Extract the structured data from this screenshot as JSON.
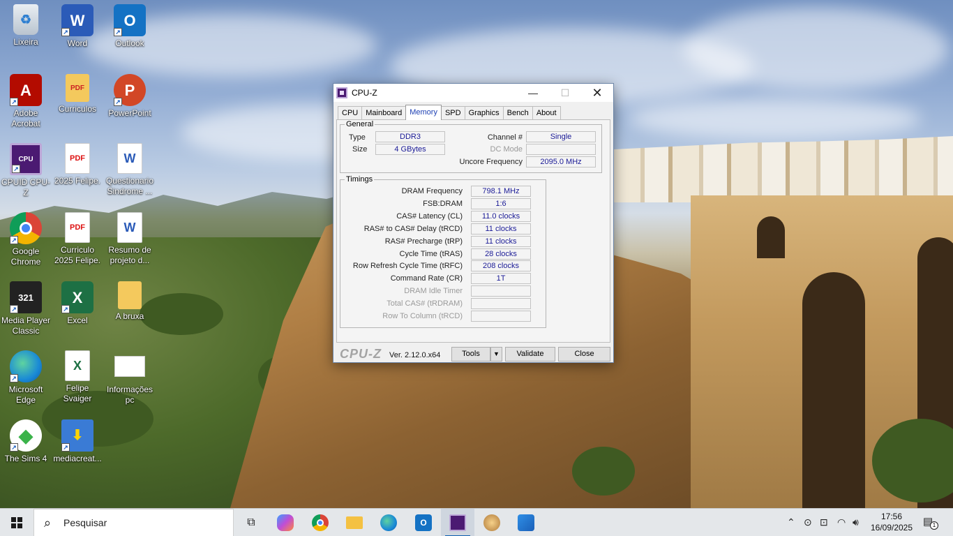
{
  "desktop": {
    "icons": [
      {
        "label": "Lixeira"
      },
      {
        "label": "Word"
      },
      {
        "label": "Outlook"
      },
      {
        "label": "Adobe Acrobat"
      },
      {
        "label": "Curriculos"
      },
      {
        "label": "PowerPoint"
      },
      {
        "label": "CPUID CPU-Z"
      },
      {
        "label": "2025 Felipe."
      },
      {
        "label": "Questionario Sindrome ..."
      },
      {
        "label": "Google Chrome"
      },
      {
        "label": "Curriculo 2025 Felipe."
      },
      {
        "label": "Resumo de projeto d..."
      },
      {
        "label": "Media Player Classic"
      },
      {
        "label": "Excel"
      },
      {
        "label": "A bruxa"
      },
      {
        "label": "Microsoft Edge"
      },
      {
        "label": "Felipe Svaiger"
      },
      {
        "label": "Informações pc"
      },
      {
        "label": "The Sims 4"
      },
      {
        "label": "mediacreat..."
      }
    ]
  },
  "cpuz": {
    "title": "CPU-Z",
    "tabs": [
      {
        "label": "CPU"
      },
      {
        "label": "Mainboard"
      },
      {
        "label": "Memory"
      },
      {
        "label": "SPD"
      },
      {
        "label": "Graphics"
      },
      {
        "label": "Bench"
      },
      {
        "label": "About"
      }
    ],
    "active_tab": "Memory",
    "general": {
      "legend": "General",
      "type_label": "Type",
      "type_value": "DDR3",
      "size_label": "Size",
      "size_value": "4 GBytes",
      "channel_label": "Channel #",
      "channel_value": "Single",
      "dc_mode_label": "DC Mode",
      "dc_mode_value": "",
      "uncore_label": "Uncore Frequency",
      "uncore_value": "2095.0 MHz"
    },
    "timings": {
      "legend": "Timings",
      "rows": [
        {
          "label": "DRAM Frequency",
          "value": "798.1 MHz",
          "dim": false
        },
        {
          "label": "FSB:DRAM",
          "value": "1:6",
          "dim": false
        },
        {
          "label": "CAS# Latency (CL)",
          "value": "11.0 clocks",
          "dim": false
        },
        {
          "label": "RAS# to CAS# Delay (tRCD)",
          "value": "11 clocks",
          "dim": false
        },
        {
          "label": "RAS# Precharge (tRP)",
          "value": "11 clocks",
          "dim": false
        },
        {
          "label": "Cycle Time (tRAS)",
          "value": "28 clocks",
          "dim": false
        },
        {
          "label": "Row Refresh Cycle Time (tRFC)",
          "value": "208 clocks",
          "dim": false
        },
        {
          "label": "Command Rate (CR)",
          "value": "1T",
          "dim": false
        },
        {
          "label": "DRAM Idle Timer",
          "value": "",
          "dim": true
        },
        {
          "label": "Total CAS# (tRDRAM)",
          "value": "",
          "dim": true
        },
        {
          "label": "Row To Column (tRCD)",
          "value": "",
          "dim": true
        }
      ]
    },
    "footer": {
      "brand": "CPU-Z",
      "version": "Ver. 2.12.0.x64",
      "tools_label": "Tools",
      "tools_arrow": "▼",
      "validate_label": "Validate",
      "close_label": "Close"
    }
  },
  "taskbar": {
    "search_placeholder": "Pesquisar",
    "time": "17:56",
    "date": "16/09/2025",
    "notification_count": "1",
    "accent": "#0e5fb0"
  }
}
